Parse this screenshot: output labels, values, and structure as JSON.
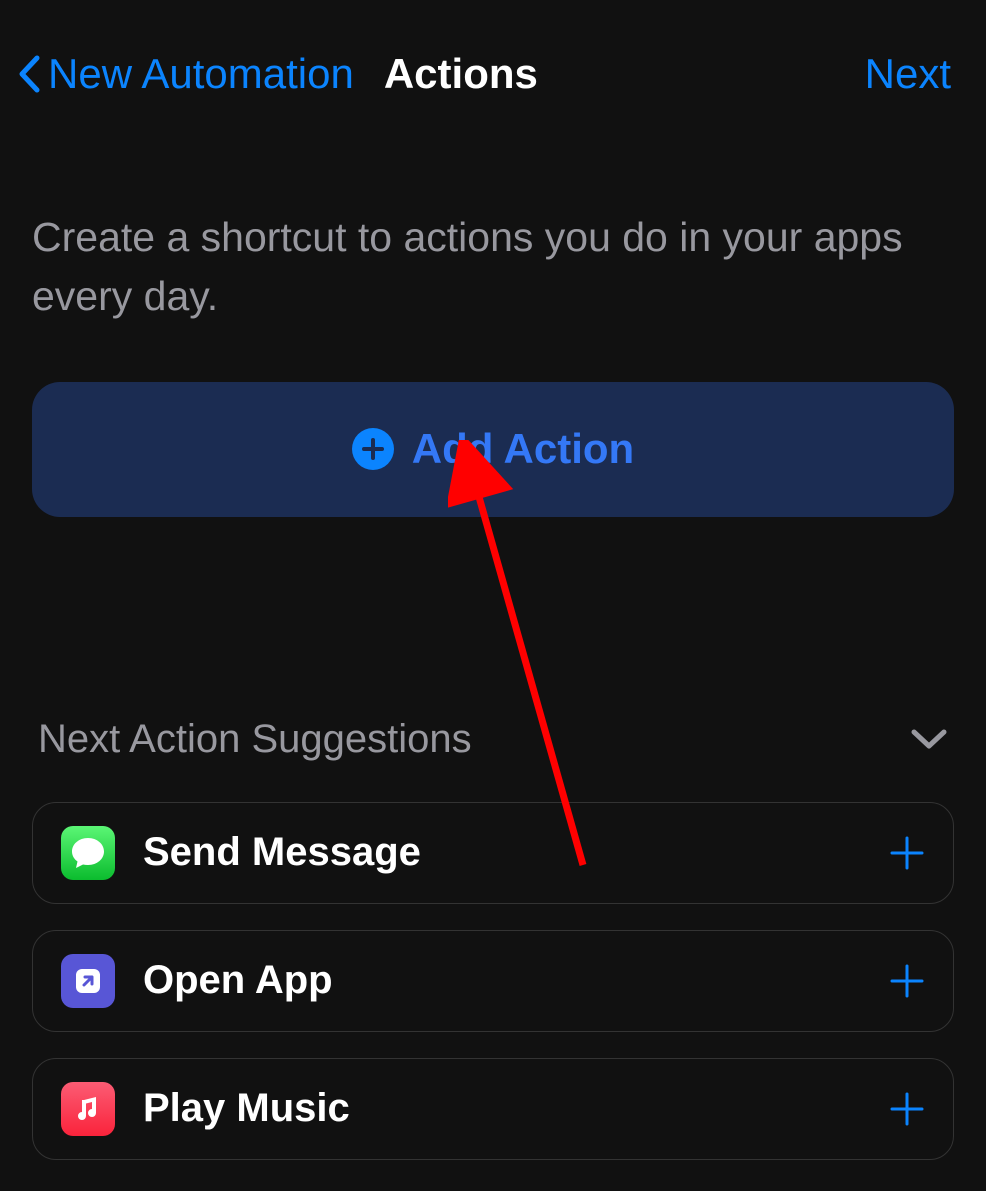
{
  "nav": {
    "back_label": "New Automation",
    "title": "Actions",
    "next_label": "Next"
  },
  "main": {
    "description": "Create a shortcut to actions you do in your apps every day.",
    "add_action_label": "Add Action"
  },
  "suggestions": {
    "heading": "Next Action Suggestions",
    "items": [
      {
        "label": "Send Message",
        "icon": "messages"
      },
      {
        "label": "Open App",
        "icon": "shortcuts"
      },
      {
        "label": "Play Music",
        "icon": "music"
      }
    ]
  },
  "colors": {
    "accent": "#0b84fe",
    "secondary_text": "#98989f",
    "add_action_bg": "#1b2c52"
  }
}
